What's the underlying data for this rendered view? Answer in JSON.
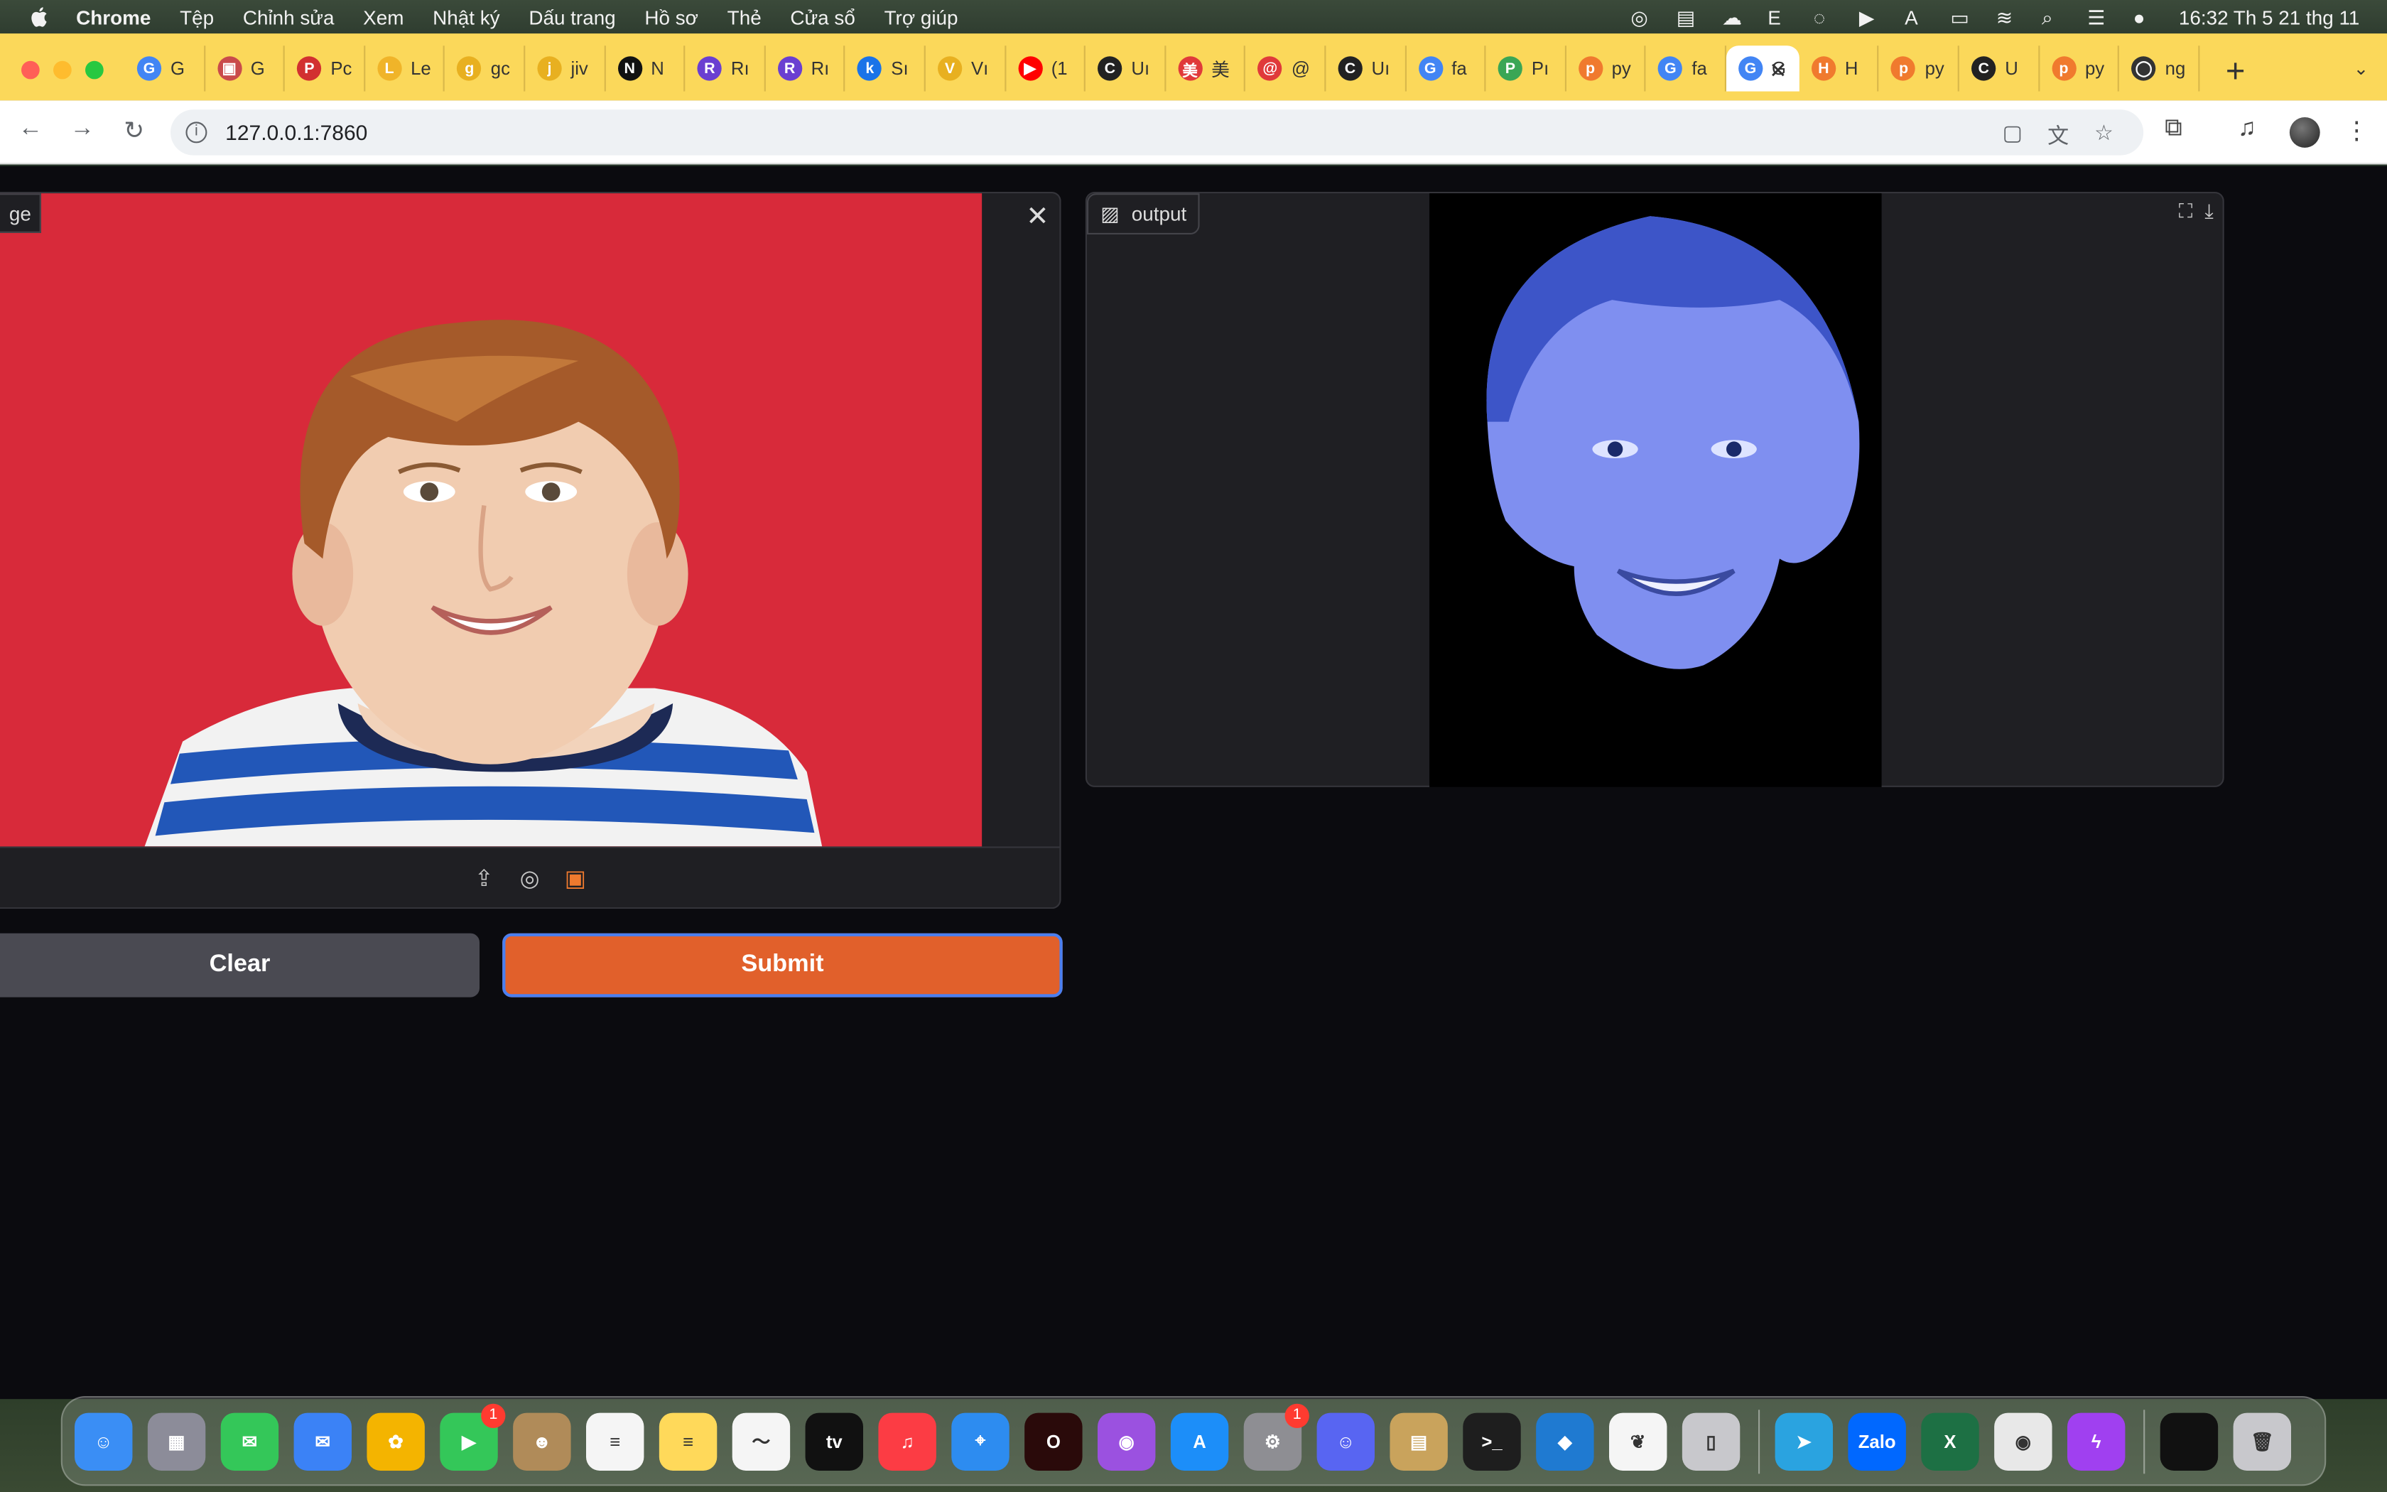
{
  "menubar": {
    "app_name": "Chrome",
    "menus": [
      "Tệp",
      "Chỉnh sửa",
      "Xem",
      "Nhật ký",
      "Dấu trang",
      "Hồ sơ",
      "Thẻ",
      "Cửa sổ",
      "Trợ giúp"
    ],
    "clock": "16:32 Th 5 21 thg 11"
  },
  "tabs": [
    {
      "initial": "G",
      "label": "G",
      "color": "#4285f4"
    },
    {
      "initial": "▣",
      "label": "G",
      "color": "#c94b4b"
    },
    {
      "initial": "P",
      "label": "Pc",
      "color": "#d23030"
    },
    {
      "initial": "L",
      "label": "Le",
      "color": "#f0b429"
    },
    {
      "initial": "g",
      "label": "gc",
      "color": "#e8b020"
    },
    {
      "initial": "j",
      "label": "jiv",
      "color": "#e8b020"
    },
    {
      "initial": "N",
      "label": "N",
      "color": "#111111"
    },
    {
      "initial": "R",
      "label": "Rı",
      "color": "#6a3fd1"
    },
    {
      "initial": "R",
      "label": "Rı",
      "color": "#6a3fd1"
    },
    {
      "initial": "k",
      "label": "Sı",
      "color": "#1a73e8"
    },
    {
      "initial": "V",
      "label": "Vı",
      "color": "#e8b020"
    },
    {
      "initial": "▶",
      "label": "(1",
      "color": "#ff0000"
    },
    {
      "initial": "C",
      "label": "Uı",
      "color": "#222222"
    },
    {
      "initial": "美",
      "label": "美",
      "color": "#e03a3a"
    },
    {
      "initial": "@",
      "label": "@",
      "color": "#e03a3a"
    },
    {
      "initial": "C",
      "label": "Uı",
      "color": "#222222"
    },
    {
      "initial": "G",
      "label": "fa",
      "color": "#4285f4"
    },
    {
      "initial": "P",
      "label": "Pı",
      "color": "#3aa655"
    },
    {
      "initial": "p",
      "label": "py",
      "color": "#f07a2e"
    },
    {
      "initial": "G",
      "label": "fa",
      "color": "#4285f4"
    },
    {
      "initial": "G",
      "label": "G",
      "color": "#4285f4",
      "active": true
    },
    {
      "initial": "H",
      "label": "H",
      "color": "#f07a2e"
    },
    {
      "initial": "p",
      "label": "py",
      "color": "#f07a2e"
    },
    {
      "initial": "C",
      "label": "U",
      "color": "#222222"
    },
    {
      "initial": "p",
      "label": "py",
      "color": "#f07a2e"
    },
    {
      "initial": "◯",
      "label": "ng",
      "color": "#333333"
    }
  ],
  "omnibox": {
    "url": "127.0.0.1:7860"
  },
  "input": {
    "label": "ge"
  },
  "output": {
    "label": "output"
  },
  "buttons": {
    "clear": "Clear",
    "submit": "Submit"
  },
  "dock": {
    "apps": [
      {
        "name": "Finder",
        "color": "#3a8ef5",
        "glyph": "☺"
      },
      {
        "name": "Launchpad",
        "color": "#8c8c99",
        "glyph": "▦"
      },
      {
        "name": "Messages",
        "color": "#34c759",
        "glyph": "✉"
      },
      {
        "name": "Mail",
        "color": "#3b82f6",
        "glyph": "✉"
      },
      {
        "name": "Photos",
        "color": "#f4b400",
        "glyph": "✿"
      },
      {
        "name": "FaceTime",
        "color": "#34c759",
        "glyph": "▶",
        "badge": "1"
      },
      {
        "name": "Contacts",
        "color": "#b08b59",
        "glyph": "☻"
      },
      {
        "name": "Reminders",
        "color": "#f5f5f5",
        "glyph": "≡"
      },
      {
        "name": "Notes",
        "color": "#ffd95a",
        "glyph": "≡"
      },
      {
        "name": "Freeform",
        "color": "#f5f5f5",
        "glyph": "〜"
      },
      {
        "name": "TV",
        "color": "#111111",
        "glyph": "tv"
      },
      {
        "name": "Music",
        "color": "#fc3c44",
        "glyph": "♫"
      },
      {
        "name": "Safari",
        "color": "#2d8cf0",
        "glyph": "⌖"
      },
      {
        "name": "Opera",
        "color": "#2a0a0a",
        "glyph": "O"
      },
      {
        "name": "Podcasts",
        "color": "#9b51e0",
        "glyph": "◉"
      },
      {
        "name": "App Store",
        "color": "#1c8ef9",
        "glyph": "A"
      },
      {
        "name": "System Settings",
        "color": "#8e8e93",
        "glyph": "⚙",
        "badge": "1"
      },
      {
        "name": "Discord",
        "color": "#5865f2",
        "glyph": "☺"
      },
      {
        "name": "Archive Utility",
        "color": "#c9a35c",
        "glyph": "▤"
      },
      {
        "name": "Terminal",
        "color": "#1e1e1e",
        "glyph": ">_"
      },
      {
        "name": "VS Code",
        "color": "#1f7ad1",
        "glyph": "◆"
      },
      {
        "name": "MongoDB Compass",
        "color": "#f5f5f5",
        "glyph": "❦"
      },
      {
        "name": "iPhone Mirroring",
        "color": "#c8c8cc",
        "glyph": "▯"
      },
      {
        "name": "Telegram",
        "color": "#2aa3e0",
        "glyph": "➤"
      },
      {
        "name": "Zalo",
        "color": "#0068ff",
        "glyph": "Zalo"
      },
      {
        "name": "Excel",
        "color": "#1d7044",
        "glyph": "X"
      },
      {
        "name": "Chrome",
        "color": "#e8e8e8",
        "glyph": "◉"
      },
      {
        "name": "Messenger",
        "color": "#a040f0",
        "glyph": "ϟ"
      }
    ],
    "extras": [
      {
        "name": "Recent Window",
        "color": "#111111",
        "glyph": ""
      },
      {
        "name": "Trash",
        "color": "#c8c8cc",
        "glyph": "🗑"
      }
    ]
  }
}
